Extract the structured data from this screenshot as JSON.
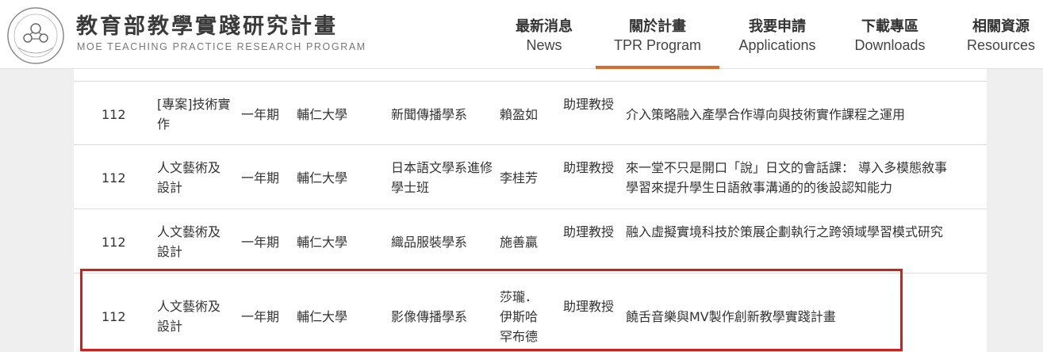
{
  "site": {
    "title": "教育部教學實踐研究計畫",
    "subtitle": "MOE TEACHING PRACTICE RESEARCH PROGRAM"
  },
  "nav": [
    {
      "zh": "最新消息",
      "en": "News",
      "active": false
    },
    {
      "zh": "關於計畫",
      "en": "TPR Program",
      "active": true
    },
    {
      "zh": "我要申請",
      "en": "Applications",
      "active": false
    },
    {
      "zh": "下載專區",
      "en": "Downloads",
      "active": false
    },
    {
      "zh": "相關資源",
      "en": "Resources",
      "active": false
    }
  ],
  "colors": {
    "accent": "#e0692a",
    "highlight_border": "#e01818"
  },
  "rows": [
    {
      "year": "112",
      "category": "[專案]技術實作",
      "term": "一年期",
      "university": "輔仁大學",
      "department": "新聞傳播學系",
      "name": "賴盈如",
      "rank": "助理教授",
      "project": "介入策略融入產學合作導向與技術實作課程之運用"
    },
    {
      "year": "112",
      "category": "人文藝術及設計",
      "term": "一年期",
      "university": "輔仁大學",
      "department": "日本語文學系進修學士班",
      "name": "李桂芳",
      "rank": "助理教授",
      "project": "來一堂不只是開口「說」日文的會話課： 導入多模態敘事學習來提升學生日語敘事溝通的的後設認知能力"
    },
    {
      "year": "112",
      "category": "人文藝術及設計",
      "term": "一年期",
      "university": "輔仁大學",
      "department": "織品服裝學系",
      "name": "施善贏",
      "rank": "助理教授",
      "project": "融入虛擬實境科技於策展企劃執行之跨領域學習模式研究"
    },
    {
      "year": "112",
      "category": "人文藝術及設計",
      "term": "一年期",
      "university": "輔仁大學",
      "department": "影像傳播學系",
      "name": "莎瓏．伊斯哈罕布德",
      "rank": "助理教授",
      "project": "饒舌音樂與MV製作創新教學實踐計畫"
    }
  ]
}
